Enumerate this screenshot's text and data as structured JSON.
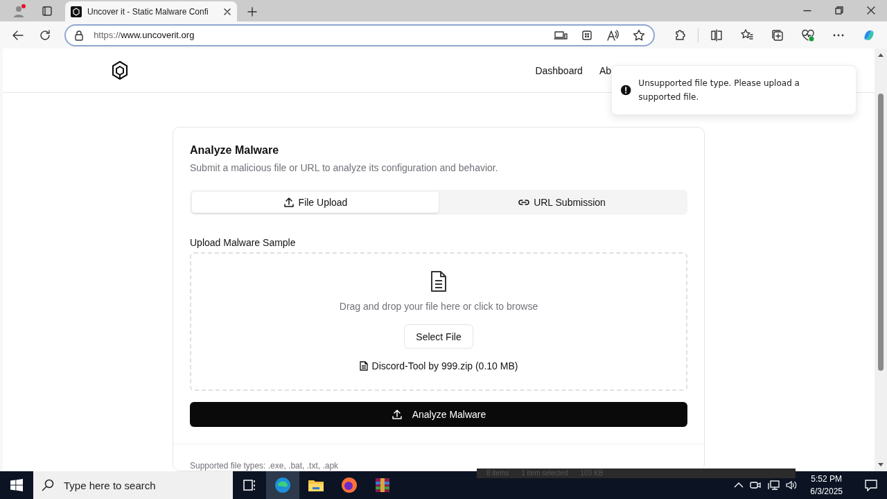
{
  "browser": {
    "tab": {
      "title": "Uncover it - Static Malware Confi",
      "selected": true
    },
    "url_scheme": "https://",
    "url_host": "www.uncoverit.org"
  },
  "header": {
    "nav": [
      "Dashboard",
      "Ab"
    ]
  },
  "toast": {
    "message": "Unsupported file type. Please upload a supported file."
  },
  "card": {
    "title": "Analyze Malware",
    "subtitle": "Submit a malicious file or URL to analyze its configuration and behavior.",
    "tabs": [
      {
        "label": "File Upload",
        "kind": "upload",
        "selected": true
      },
      {
        "label": "URL Submission",
        "kind": "link",
        "selected": false
      }
    ],
    "upload_label": "Upload Malware Sample",
    "drop_hint": "Drag and drop your file here or click to browse",
    "select_button": "Select File",
    "file_name": "Discord-Tool by 999.zip (0.10 MB)",
    "analyze_button": "Analyze Malware",
    "footer_note": "Supported file types: .exe, .bat, .txt, .apk"
  },
  "background_window": {
    "items": [
      "8 items",
      "1 item selected",
      "103 KB"
    ]
  },
  "taskbar": {
    "search_placeholder": "Type here to search",
    "time": "5:52 PM",
    "date": "6/3/2025"
  }
}
